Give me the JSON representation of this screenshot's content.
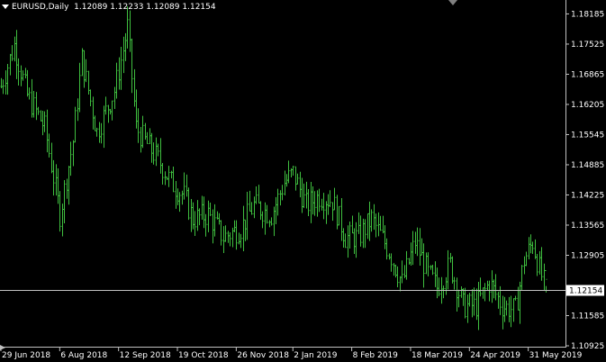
{
  "header": {
    "symbol": "EURUSD,Daily",
    "ohlc": "1.12089 1.12233 1.12089 1.12154"
  },
  "colors": {
    "background": "#000000",
    "bars": "#3fbf3f",
    "axis": "#c0c0c0",
    "text": "#ffffff",
    "price_line": "#c0c0c0",
    "price_tag_bg": "#ffffff",
    "price_tag_text": "#000000"
  },
  "current_price": {
    "label": "1.12154",
    "value": 1.12154
  },
  "chart_data": {
    "type": "bar",
    "y_ticks": [
      {
        "label": "1.18185",
        "value": 1.18185
      },
      {
        "label": "1.17525",
        "value": 1.17525
      },
      {
        "label": "1.16865",
        "value": 1.16865
      },
      {
        "label": "1.16205",
        "value": 1.16205
      },
      {
        "label": "1.15545",
        "value": 1.15545
      },
      {
        "label": "1.14885",
        "value": 1.14885
      },
      {
        "label": "1.14225",
        "value": 1.14225
      },
      {
        "label": "1.13565",
        "value": 1.13565
      },
      {
        "label": "1.12905",
        "value": 1.12905
      },
      {
        "label": "1.11585",
        "value": 1.11585
      },
      {
        "label": "1.10925",
        "value": 1.10925
      }
    ],
    "x_ticks": [
      {
        "label": "29 Jun 2018",
        "index": 0
      },
      {
        "label": "6 Aug 2018",
        "index": 27
      },
      {
        "label": "12 Sep 2018",
        "index": 54
      },
      {
        "label": "19 Oct 2018",
        "index": 81
      },
      {
        "label": "26 Nov 2018",
        "index": 108
      },
      {
        "label": "2 Jan 2019",
        "index": 134
      },
      {
        "label": "8 Feb 2019",
        "index": 161
      },
      {
        "label": "18 Mar 2019",
        "index": 188
      },
      {
        "label": "24 Apr 2019",
        "index": 215
      },
      {
        "label": "31 May 2019",
        "index": 242
      }
    ],
    "ylim": [
      1.10925,
      1.1845
    ],
    "anchors": [
      [
        0,
        1.166
      ],
      [
        6,
        1.175
      ],
      [
        12,
        1.164
      ],
      [
        20,
        1.157
      ],
      [
        27,
        1.138
      ],
      [
        33,
        1.154
      ],
      [
        37,
        1.172
      ],
      [
        44,
        1.156
      ],
      [
        52,
        1.165
      ],
      [
        56,
        1.174
      ],
      [
        58,
        1.179
      ],
      [
        62,
        1.157
      ],
      [
        66,
        1.154
      ],
      [
        72,
        1.15
      ],
      [
        78,
        1.145
      ],
      [
        84,
        1.142
      ],
      [
        88,
        1.137
      ],
      [
        95,
        1.138
      ],
      [
        102,
        1.133
      ],
      [
        110,
        1.135
      ],
      [
        116,
        1.14
      ],
      [
        124,
        1.138
      ],
      [
        130,
        1.145
      ],
      [
        134,
        1.147
      ],
      [
        140,
        1.14
      ],
      [
        146,
        1.142
      ],
      [
        152,
        1.141
      ],
      [
        158,
        1.133
      ],
      [
        164,
        1.133
      ],
      [
        170,
        1.137
      ],
      [
        178,
        1.13
      ],
      [
        184,
        1.123
      ],
      [
        190,
        1.132
      ],
      [
        196,
        1.125
      ],
      [
        200,
        1.122
      ],
      [
        206,
        1.127
      ],
      [
        212,
        1.118
      ],
      [
        218,
        1.118
      ],
      [
        224,
        1.123
      ],
      [
        230,
        1.118
      ],
      [
        236,
        1.117
      ],
      [
        240,
        1.128
      ],
      [
        244,
        1.132
      ],
      [
        247,
        1.126
      ],
      [
        250,
        1.1215
      ]
    ],
    "bar_count": 251
  }
}
